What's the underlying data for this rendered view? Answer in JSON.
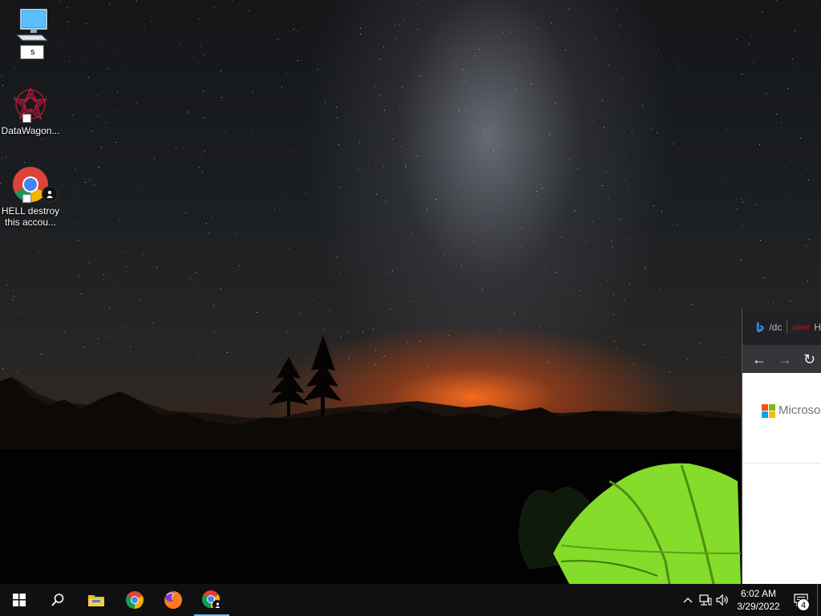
{
  "desktop": {
    "icons": [
      {
        "label": "",
        "rename_value": "s"
      },
      {
        "label": "DataWagon..."
      },
      {
        "label_line1": "HELL destroy",
        "label_line2": "this accou..."
      }
    ]
  },
  "browser": {
    "tab1_text": "/dc",
    "tab2_text": "H",
    "cnet_badge": "c|net",
    "nav": {
      "back": "←",
      "forward": "→",
      "reload": "↻"
    },
    "page_brand": "Microso"
  },
  "taskbar": {
    "apps": [
      "start-icon",
      "search-icon",
      "file-explorer-icon",
      "chrome-icon",
      "firefox-icon",
      "chrome-profile-icon"
    ],
    "tray": {
      "chevron": "^",
      "volume": "🔊"
    },
    "clock": {
      "time": "6:02 AM",
      "date": "3/29/2022"
    },
    "notifications_count": "4"
  },
  "colors": {
    "taskbar": "#101010",
    "accent": "#76b9ed",
    "tent_green": "#7ed321",
    "sunset_orange": "#ff6e1e"
  }
}
